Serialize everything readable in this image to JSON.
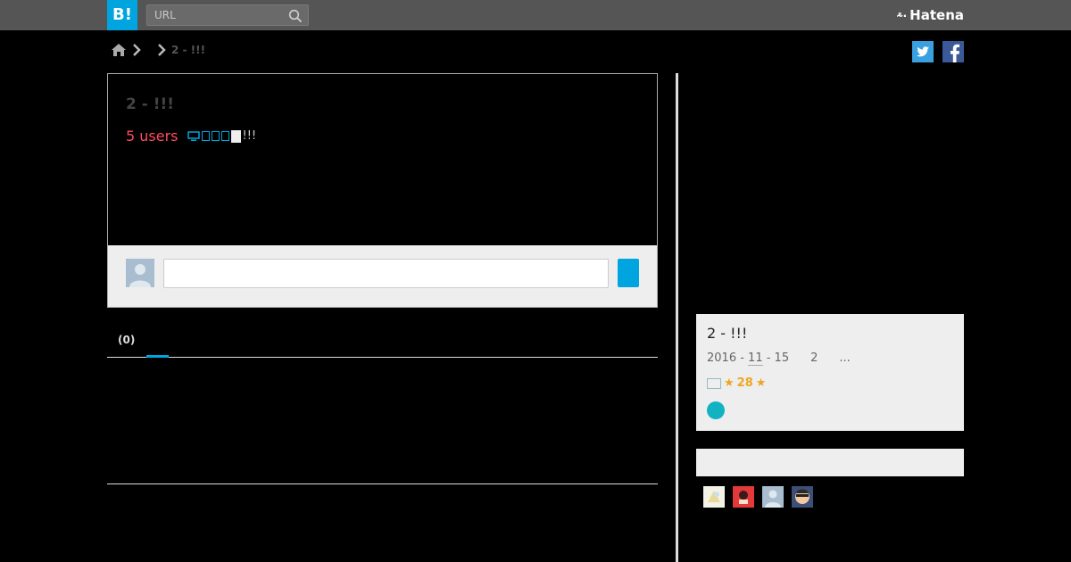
{
  "header": {
    "logo": "B!",
    "search_placeholder": "URL",
    "brand": "Hatena",
    "brand_mark": "⸛·"
  },
  "breadcrumb": {
    "title": "2 - !!!"
  },
  "entry": {
    "title": "2 - !!!",
    "users": "5 users",
    "site_text": "!!!"
  },
  "tabs": {
    "count_label": "(0)"
  },
  "side": {
    "title": "2 - !!!",
    "date_parts": [
      "2016 - ",
      "11",
      " - 15"
    ],
    "num": "2",
    "ellipsis": "...",
    "stars": "28"
  },
  "colors": {
    "accent": "#00a4de",
    "users": "#ff4b5c",
    "star": "#f0a61f",
    "dot": "#11b3c3"
  }
}
